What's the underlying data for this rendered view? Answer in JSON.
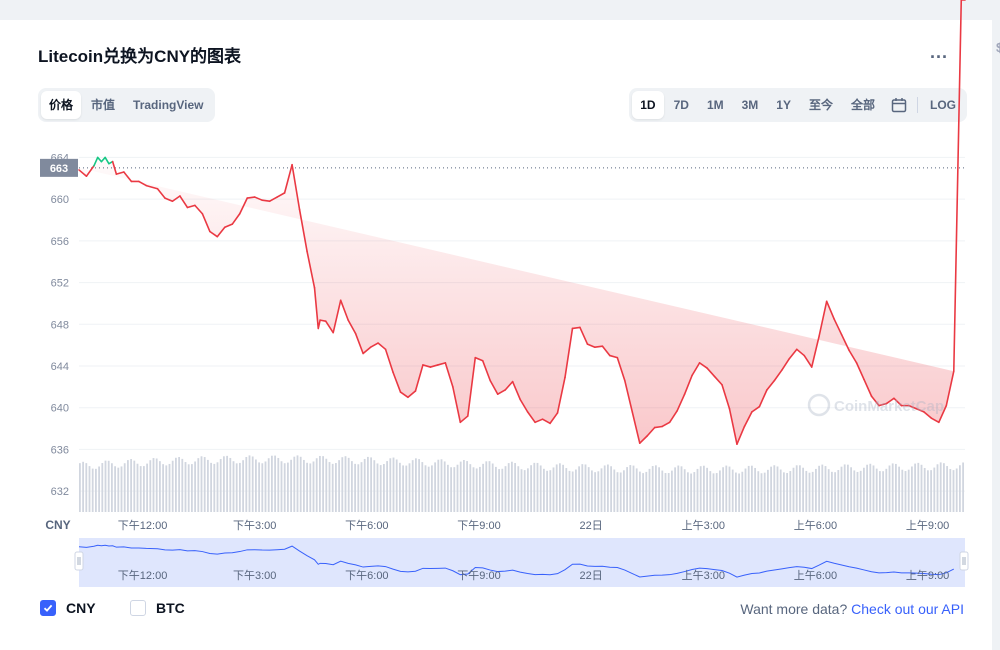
{
  "header": {
    "title": "Litecoin兑换为CNY的图表",
    "more_label": "..."
  },
  "tabs": [
    {
      "label": "价格",
      "active": true
    },
    {
      "label": "市值",
      "active": false
    },
    {
      "label": "TradingView",
      "active": false
    }
  ],
  "ranges": [
    {
      "label": "1D",
      "active": true
    },
    {
      "label": "7D",
      "active": false
    },
    {
      "label": "1M",
      "active": false
    },
    {
      "label": "3M",
      "active": false
    },
    {
      "label": "1Y",
      "active": false
    },
    {
      "label": "至今",
      "active": false
    },
    {
      "label": "全部",
      "active": false
    }
  ],
  "range_extra": {
    "calendar_icon": "calendar-icon",
    "log_label": "LOG"
  },
  "legend": {
    "cny_label": "CNY",
    "cny_checked": true,
    "btc_label": "BTC",
    "btc_checked": false
  },
  "api": {
    "prompt": "Want more data?",
    "link": "Check out our API"
  },
  "watermark": "CoinMarketCap",
  "colors": {
    "down": "#ea3943",
    "up": "#16c784",
    "accent": "#3861fb",
    "navigator": "#dfe6fd"
  },
  "chart_data": {
    "type": "line",
    "currency_label": "CNY",
    "open_price": 663,
    "current_price_label": "663",
    "ylim": [
      630,
      665
    ],
    "yticks": [
      664,
      660,
      656,
      652,
      648,
      644,
      640,
      636,
      632
    ],
    "grid": true,
    "xlim": [
      10.3,
      34.0
    ],
    "xticks": [
      {
        "x": 12,
        "label": "下午12:00"
      },
      {
        "x": 15,
        "label": "下午3:00"
      },
      {
        "x": 18,
        "label": "下午6:00"
      },
      {
        "x": 21,
        "label": "下午9:00"
      },
      {
        "x": 24,
        "label": "22日"
      },
      {
        "x": 27,
        "label": "上午3:00"
      },
      {
        "x": 30,
        "label": "上午6:00"
      },
      {
        "x": 33,
        "label": "上午9:00"
      }
    ],
    "x": [
      10.3,
      10.5,
      10.7,
      10.8,
      10.9,
      11.0,
      11.1,
      11.2,
      11.3,
      11.5,
      11.7,
      11.9,
      12.1,
      12.4,
      12.6,
      12.8,
      13.0,
      13.2,
      13.4,
      13.6,
      13.8,
      14.0,
      14.2,
      14.4,
      14.6,
      14.8,
      15.0,
      15.2,
      15.4,
      15.6,
      15.8,
      16.0,
      16.2,
      16.4,
      16.6,
      16.7,
      16.75,
      16.9,
      17.1,
      17.3,
      17.5,
      17.7,
      17.9,
      18.1,
      18.3,
      18.5,
      18.7,
      18.9,
      19.1,
      19.3,
      19.5,
      19.7,
      19.9,
      20.1,
      20.3,
      20.5,
      20.7,
      20.9,
      21.1,
      21.3,
      21.5,
      21.7,
      21.9,
      22.1,
      22.3,
      22.5,
      22.7,
      22.9,
      23.1,
      23.3,
      23.5,
      23.7,
      23.9,
      24.1,
      24.3,
      24.5,
      24.7,
      24.9,
      25.1,
      25.3,
      25.5,
      25.7,
      25.9,
      26.1,
      26.3,
      26.5,
      26.7,
      26.9,
      27.1,
      27.3,
      27.5,
      27.7,
      27.9,
      28.1,
      28.3,
      28.5,
      28.7,
      28.9,
      29.1,
      29.3,
      29.5,
      29.7,
      29.9,
      30.1,
      30.3,
      30.5,
      30.7,
      30.9,
      31.1,
      31.3,
      31.5,
      31.7,
      31.9,
      32.1,
      32.3,
      32.5,
      32.7,
      32.9,
      33.1,
      33.3,
      33.5,
      33.7,
      33.9,
      34.0
    ],
    "y": [
      662.8,
      662.2,
      663.2,
      664.0,
      663.6,
      664.0,
      663.4,
      663.6,
      662.4,
      662.6,
      661.7,
      661.7,
      661.3,
      661.0,
      660.1,
      659.8,
      660.3,
      659.2,
      659.4,
      658.6,
      656.9,
      656.4,
      657.3,
      657.6,
      658.6,
      660.1,
      660.2,
      659.9,
      659.8,
      660.2,
      660.6,
      663.3,
      659.0,
      655.0,
      651.5,
      647.6,
      648.4,
      648.3,
      647.2,
      650.3,
      648.4,
      647.1,
      645.2,
      645.8,
      646.2,
      645.6,
      643.4,
      641.5,
      641.0,
      641.6,
      644.1,
      643.9,
      644.1,
      644.3,
      642.0,
      638.6,
      639.2,
      644.8,
      644.5,
      642.6,
      641.3,
      641.7,
      642.5,
      640.8,
      639.6,
      638.6,
      638.9,
      638.5,
      639.5,
      642.9,
      647.6,
      647.7,
      646.1,
      645.8,
      645.9,
      645.0,
      644.8,
      642.6,
      639.6,
      636.6,
      637.3,
      638.1,
      638.2,
      638.6,
      639.7,
      641.3,
      643.1,
      644.3,
      643.8,
      643.0,
      642.2,
      639.9,
      636.5,
      638.2,
      639.6,
      640.1,
      641.7,
      642.6,
      643.6,
      644.7,
      645.6,
      645.0,
      643.9,
      646.9,
      650.2,
      648.5,
      647.0,
      645.5,
      644.3,
      642.7,
      641.1,
      640.2,
      640.4,
      640.9,
      640.2,
      640.2,
      639.9,
      639.6,
      639.0,
      638.6,
      640.2,
      643.5
    ]
  }
}
